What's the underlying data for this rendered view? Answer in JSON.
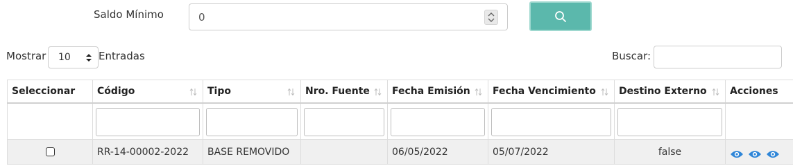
{
  "filters": {
    "saldo_label": "Saldo Mínimo",
    "saldo_value": "0",
    "accent": "#5bb8ac"
  },
  "controls": {
    "mostrar_label": "Mostrar",
    "entries_value": "10",
    "entradas_label": "Entradas",
    "buscar_label": "Buscar:",
    "buscar_value": ""
  },
  "table": {
    "headers": [
      "Seleccionar",
      "Código",
      "Tipo",
      "Nro. Fuente",
      "Fecha Emisión",
      "Fecha Vencimiento",
      "Destino Externo",
      "Acciones"
    ],
    "rows": [
      {
        "codigo": "RR-14-00002-2022",
        "tipo": "BASE REMOVIDO",
        "nro_fuente": "",
        "fecha_emision": "06/05/2022",
        "fecha_vencimiento": "05/07/2022",
        "destino_externo": "false",
        "actions": [
          "eye-icon",
          "eye-icon",
          "eye-icon"
        ]
      }
    ]
  }
}
